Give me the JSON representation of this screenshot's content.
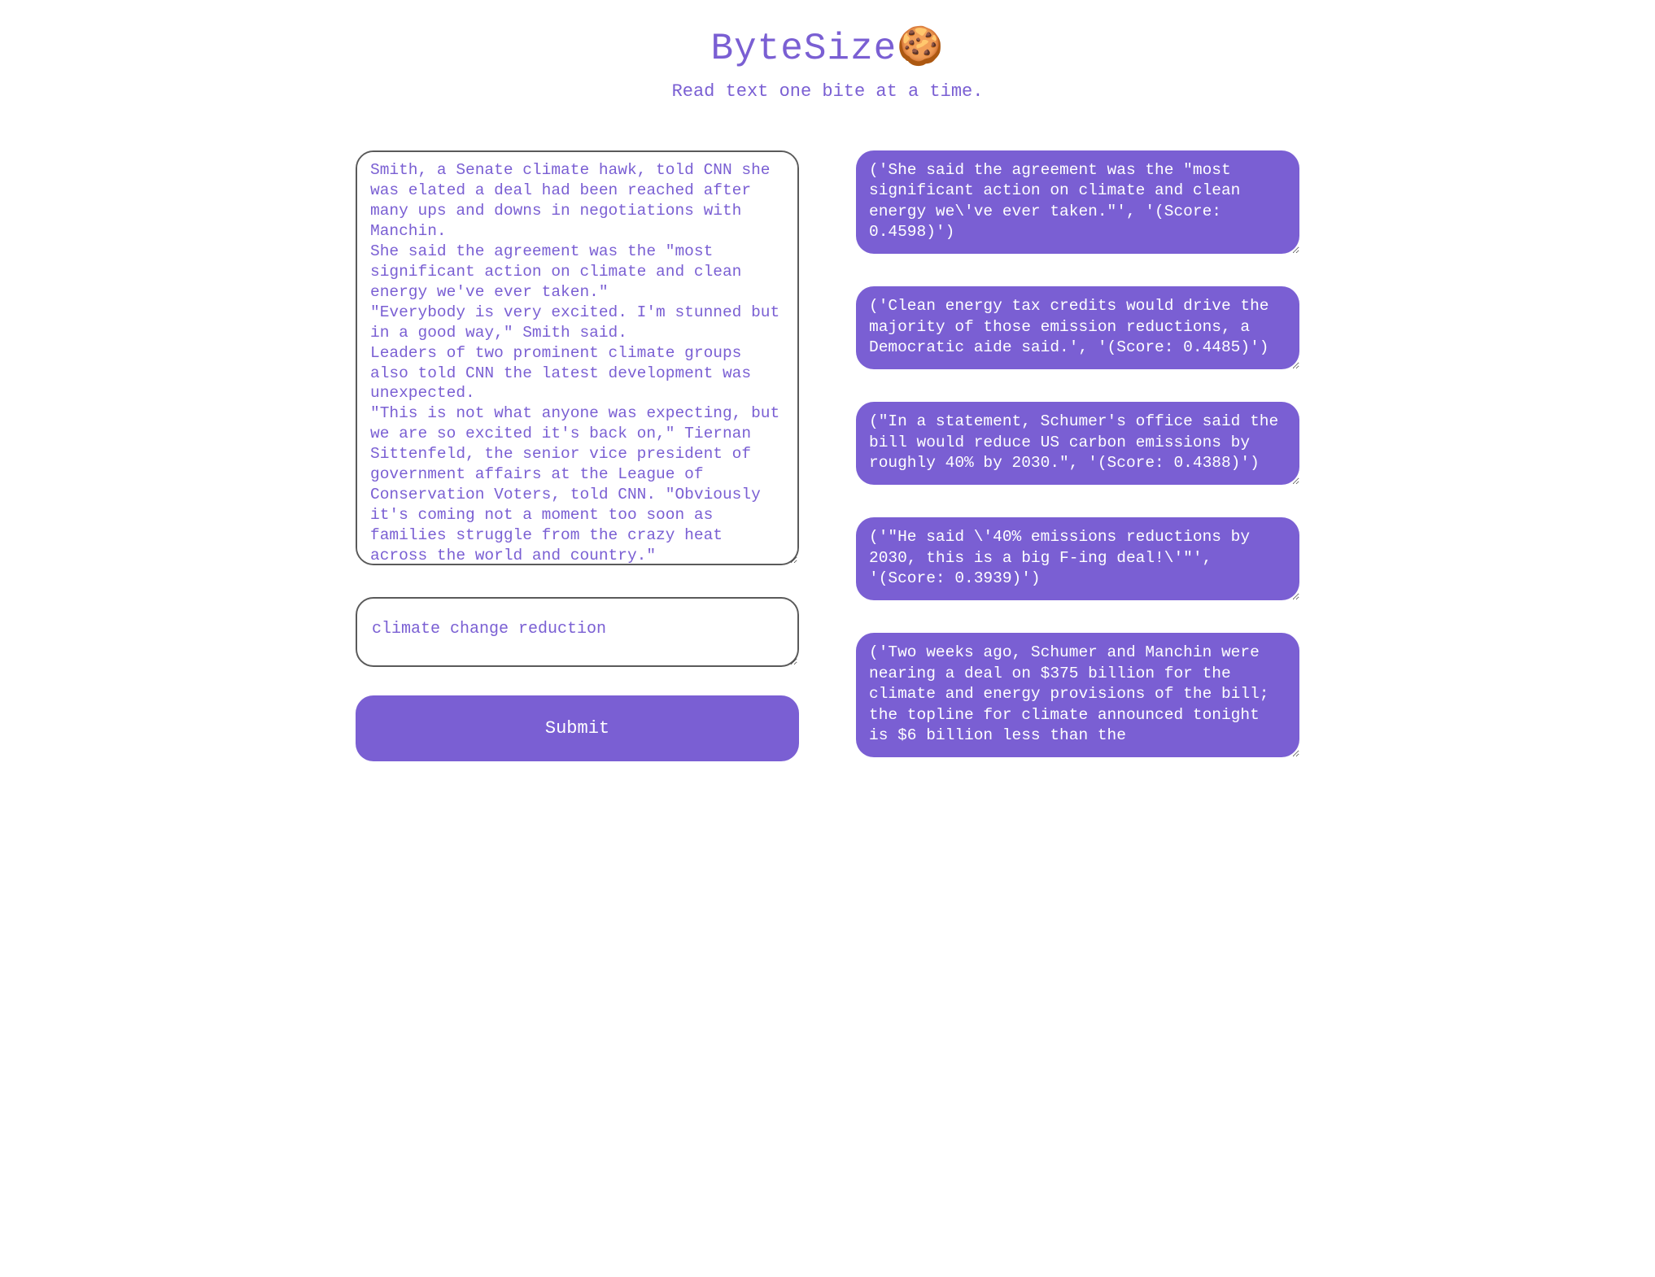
{
  "header": {
    "title_text": "ByteSize",
    "title_emoji": "🍪",
    "tagline": "Read text one bite at a time."
  },
  "inputs": {
    "source_text": "Smith, a Senate climate hawk, told CNN she was elated a deal had been reached after many ups and downs in negotiations with Manchin.\nShe said the agreement was the \"most significant action on climate and clean energy we've ever taken.\"\n\"Everybody is very excited. I'm stunned but in a good way,\" Smith said.\nLeaders of two prominent climate groups also told CNN the latest development was unexpected.\n\"This is not what anyone was expecting, but we are so excited it's back on,\" Tiernan Sittenfeld, the senior vice president of government affairs at the League of Conservation Voters, told CNN. \"Obviously it's coming not a moment too soon as families struggle from the crazy heat across the world and country.\"",
    "query_text": "climate change reduction",
    "submit_label": "Submit"
  },
  "results": [
    {
      "text": "('She said the agreement was the \"most significant action on climate and clean energy we\\'ve ever taken.\"', '(Score: 0.4598)')"
    },
    {
      "text": "('Clean energy tax credits would drive the majority of those emission reductions, a Democratic aide said.', '(Score: 0.4485)')"
    },
    {
      "text": "(\"In a statement, Schumer's office said the bill would reduce US carbon emissions by roughly 40% by 2030.\", '(Score: 0.4388)')"
    },
    {
      "text": "('\"He said \\'40% emissions reductions by 2030, this is a big F-ing deal!\\'\"', '(Score: 0.3939)')"
    },
    {
      "text": "('Two weeks ago, Schumer and Manchin were nearing a deal on $375 billion for the climate and energy provisions of the bill; the topline for climate announced tonight is $6 billion less than the"
    }
  ]
}
